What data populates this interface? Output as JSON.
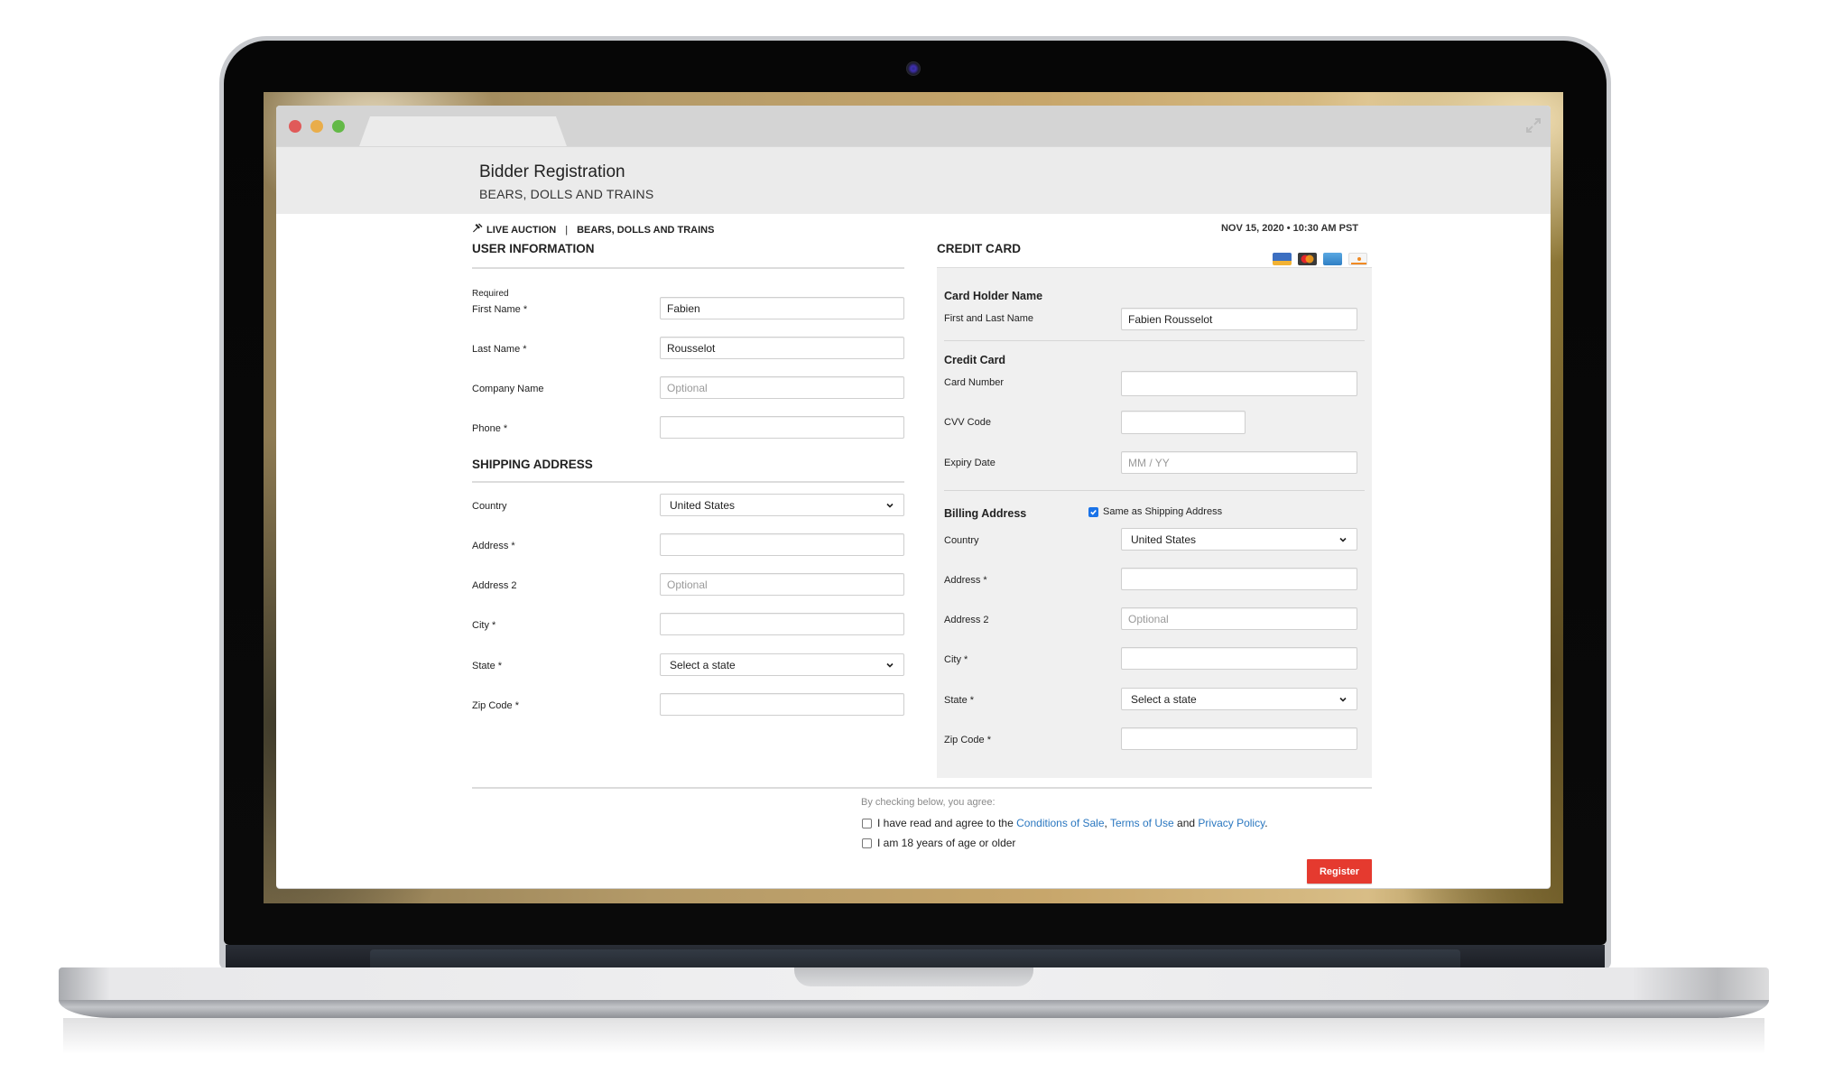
{
  "window": {
    "controls": [
      "close",
      "minimize",
      "maximize"
    ],
    "expand_icon": "expand-arrows-icon"
  },
  "header": {
    "title": "Bidder Registration",
    "subtitle": "BEARS, DOLLS AND TRAINS"
  },
  "breadcrumb": {
    "icon": "gavel-icon",
    "auction_type": "LIVE AUCTION",
    "separator": "|",
    "auction_name": "BEARS, DOLLS AND TRAINS"
  },
  "date": "NOV 15, 2020 • 10:30 AM PST",
  "user_info": {
    "title": "USER INFORMATION",
    "required_note": "Required",
    "fields": [
      {
        "label": "First Name *",
        "value": "Fabien",
        "placeholder": ""
      },
      {
        "label": "Last Name *",
        "value": "Rousselot",
        "placeholder": ""
      },
      {
        "label": "Company Name",
        "value": "",
        "placeholder": "Optional"
      },
      {
        "label": "Phone *",
        "value": "",
        "placeholder": ""
      }
    ]
  },
  "shipping": {
    "title": "SHIPPING ADDRESS",
    "country": {
      "label": "Country",
      "selected": "United States"
    },
    "address": {
      "label": "Address *",
      "value": "",
      "placeholder": ""
    },
    "address2": {
      "label": "Address 2",
      "value": "",
      "placeholder": "Optional"
    },
    "city": {
      "label": "City *",
      "value": "",
      "placeholder": ""
    },
    "state": {
      "label": "State *",
      "selected": "Select a state"
    },
    "zip": {
      "label": "Zip Code *",
      "value": "",
      "placeholder": ""
    }
  },
  "credit_card": {
    "title": "CREDIT CARD",
    "card_icons": [
      {
        "name": "visa",
        "label": "VISA",
        "color": "#2b59a8"
      },
      {
        "name": "mastercard",
        "label": "MasterCard",
        "color": "#3a3a3a"
      },
      {
        "name": "amex",
        "label": "American Express",
        "color": "#3a8fd1"
      },
      {
        "name": "discover",
        "label": "DISCOVER",
        "color": "#f2f2f2"
      }
    ],
    "holder": {
      "title": "Card Holder Name",
      "label": "First and Last Name",
      "value": "Fabien Rousselot"
    },
    "card": {
      "title": "Credit Card",
      "number_label": "Card Number",
      "number_value": "",
      "cvv_label": "CVV Code",
      "cvv_value": "",
      "expiry_label": "Expiry Date",
      "expiry_placeholder": "MM / YY"
    },
    "billing": {
      "title": "Billing Address",
      "same_as_shipping_label": "Same as Shipping Address",
      "same_as_shipping_checked": true,
      "country": {
        "label": "Country",
        "selected": "United States"
      },
      "address": {
        "label": "Address *",
        "value": "",
        "placeholder": ""
      },
      "address2": {
        "label": "Address 2",
        "value": "",
        "placeholder": "Optional"
      },
      "city": {
        "label": "City *",
        "value": "",
        "placeholder": ""
      },
      "state": {
        "label": "State *",
        "selected": "Select a state"
      },
      "zip": {
        "label": "Zip Code *",
        "value": "",
        "placeholder": ""
      }
    }
  },
  "agreement": {
    "hint": "By checking below, you agree:",
    "terms_prefix": "I have read and agree to the",
    "conditions_link": "Conditions of Sale",
    "comma": ",",
    "terms_link": "Terms of Use",
    "and": "and",
    "privacy_link": "Privacy Policy",
    "period": ".",
    "terms_checked": false,
    "age_label": "I am 18 years of age or older",
    "age_checked": false
  },
  "register_label": "Register",
  "colors": {
    "accent_red": "#e53a2f",
    "link_blue": "#2a77c0",
    "checkbox_blue": "#1a73e8"
  }
}
